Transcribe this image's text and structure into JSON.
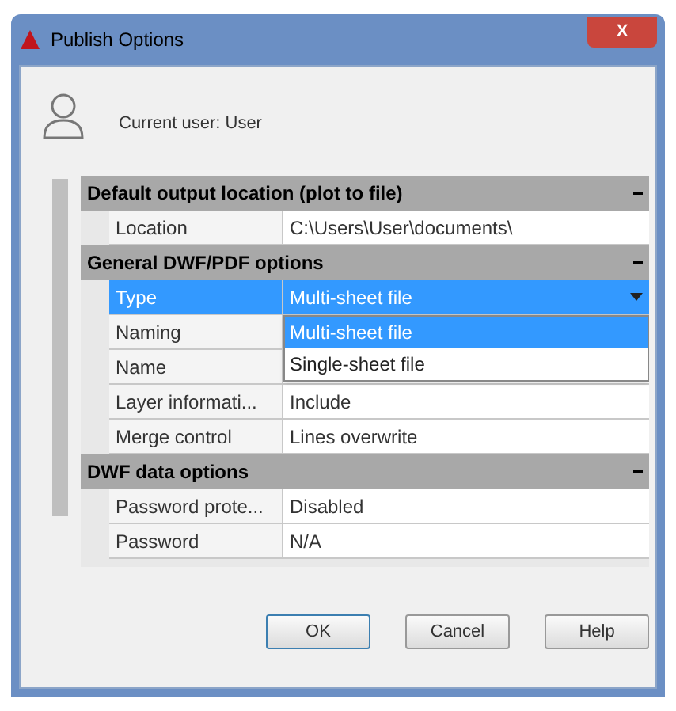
{
  "window": {
    "title": "Publish Options",
    "close": "X"
  },
  "current_user": "Current user: User",
  "sections": [
    {
      "title": "Default output location (plot to file)",
      "expanded": true,
      "rows": [
        {
          "name": "Location",
          "value": "C:\\Users\\User\\documents\\",
          "selected": false
        }
      ]
    },
    {
      "title": "General DWF/PDF options",
      "expanded": true,
      "rows": [
        {
          "name": "Type",
          "value": "Multi-sheet file",
          "selected": true,
          "dropdown": {
            "open": true,
            "options": [
              {
                "label": "Multi-sheet file",
                "selected": true
              },
              {
                "label": "Single-sheet file",
                "selected": false
              }
            ]
          }
        },
        {
          "name": "Naming",
          "selected": false
        },
        {
          "name": "Name",
          "selected": false
        },
        {
          "name": "Layer informati...",
          "value": "Include",
          "selected": false
        },
        {
          "name": "Merge control",
          "value": "Lines overwrite",
          "selected": false
        }
      ]
    },
    {
      "title": "DWF data options",
      "expanded": true,
      "rows": [
        {
          "name": "Password prote...",
          "value": "Disabled",
          "selected": false
        },
        {
          "name": "Password",
          "value": "N/A",
          "selected": false
        }
      ]
    }
  ],
  "buttons": [
    "OK",
    "Cancel",
    "Help"
  ]
}
